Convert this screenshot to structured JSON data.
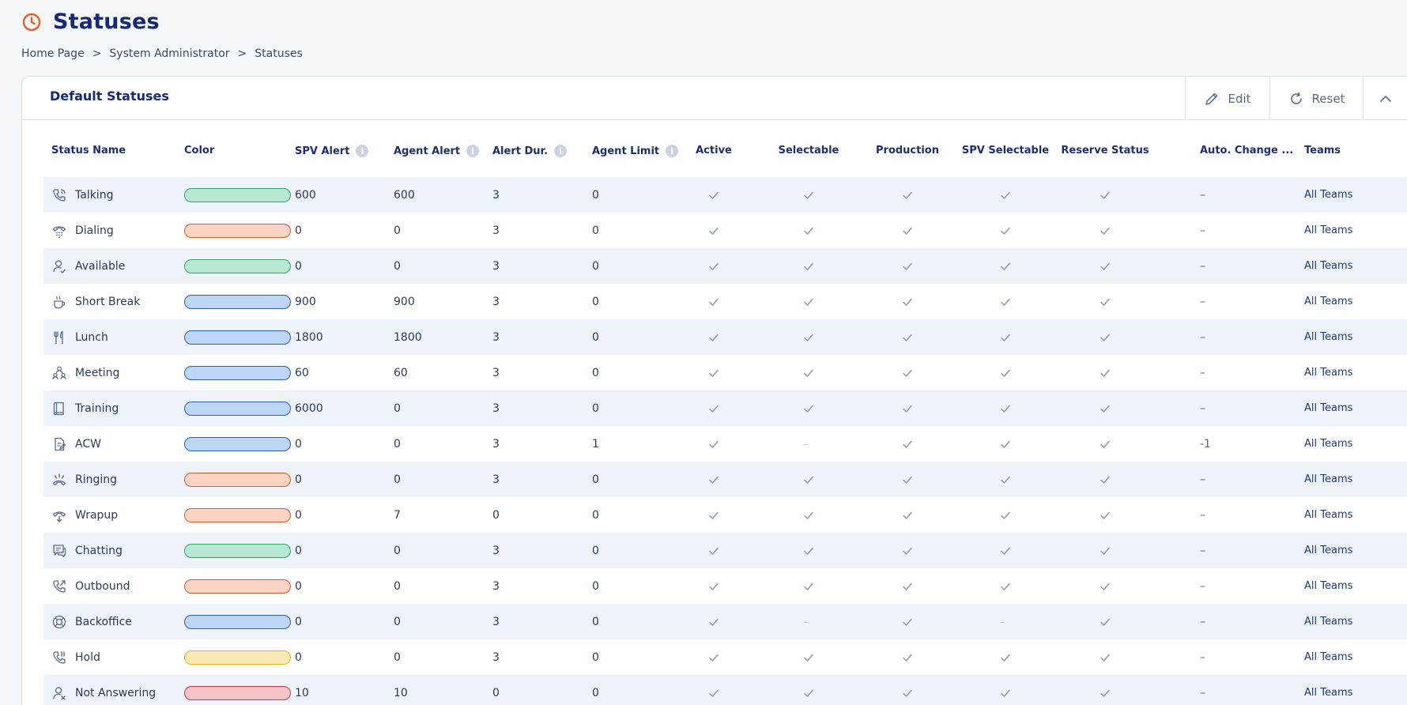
{
  "page": {
    "title": "Statuses",
    "breadcrumb": [
      "Home Page",
      "System Administrator",
      "Statuses"
    ],
    "breadcrumb_sep": ">"
  },
  "card": {
    "title": "Default Statuses",
    "edit_label": "Edit",
    "reset_label": "Reset"
  },
  "colors": {
    "green": {
      "fill": "#b8e9d3",
      "border": "#2fa86a"
    },
    "orange": {
      "fill": "#fdd3c4",
      "border": "#e0582f"
    },
    "blue": {
      "fill": "#bdd5f6",
      "border": "#2b5fb8"
    },
    "yellow": {
      "fill": "#fbe9b5",
      "border": "#d9b42c"
    },
    "red": {
      "fill": "#f6c3c8",
      "border": "#d93545"
    }
  },
  "columns": [
    {
      "label": "Status Name",
      "info": false
    },
    {
      "label": "Color",
      "info": false
    },
    {
      "label": "SPV Alert",
      "info": true
    },
    {
      "label": "Agent Alert",
      "info": true
    },
    {
      "label": "Alert Dur.",
      "info": true
    },
    {
      "label": "Agent Limit",
      "info": true
    },
    {
      "label": "Active",
      "info": false
    },
    {
      "label": "Selectable",
      "info": false
    },
    {
      "label": "Production",
      "info": false
    },
    {
      "label": "SPV Selectable",
      "info": false
    },
    {
      "label": "Reserve Status",
      "info": false
    },
    {
      "label": "Auto. Change ...",
      "info": false
    },
    {
      "label": "Teams",
      "info": false
    }
  ],
  "rows": [
    {
      "name": "Talking",
      "icon": "phone-talking-icon",
      "color": "green",
      "spv_alert": "600",
      "agent_alert": "600",
      "alert_dur": "3",
      "agent_limit": "0",
      "active": true,
      "selectable": true,
      "production": true,
      "spv_selectable": true,
      "reserve": true,
      "auto_change": "–",
      "teams": "All Teams"
    },
    {
      "name": "Dialing",
      "icon": "phone-dialing-icon",
      "color": "orange",
      "spv_alert": "0",
      "agent_alert": "0",
      "alert_dur": "3",
      "agent_limit": "0",
      "active": true,
      "selectable": true,
      "production": true,
      "spv_selectable": true,
      "reserve": true,
      "auto_change": "–",
      "teams": "All Teams"
    },
    {
      "name": "Available",
      "icon": "user-available-icon",
      "color": "green",
      "spv_alert": "0",
      "agent_alert": "0",
      "alert_dur": "3",
      "agent_limit": "0",
      "active": true,
      "selectable": true,
      "production": true,
      "spv_selectable": true,
      "reserve": true,
      "auto_change": "–",
      "teams": "All Teams"
    },
    {
      "name": "Short Break",
      "icon": "coffee-cup-icon",
      "color": "blue",
      "spv_alert": "900",
      "agent_alert": "900",
      "alert_dur": "3",
      "agent_limit": "0",
      "active": true,
      "selectable": true,
      "production": true,
      "spv_selectable": true,
      "reserve": true,
      "auto_change": "–",
      "teams": "All Teams"
    },
    {
      "name": "Lunch",
      "icon": "fork-knife-icon",
      "color": "blue",
      "spv_alert": "1800",
      "agent_alert": "1800",
      "alert_dur": "3",
      "agent_limit": "0",
      "active": true,
      "selectable": true,
      "production": true,
      "spv_selectable": true,
      "reserve": true,
      "auto_change": "–",
      "teams": "All Teams"
    },
    {
      "name": "Meeting",
      "icon": "meeting-group-icon",
      "color": "blue",
      "spv_alert": "60",
      "agent_alert": "60",
      "alert_dur": "3",
      "agent_limit": "0",
      "active": true,
      "selectable": true,
      "production": true,
      "spv_selectable": true,
      "reserve": true,
      "auto_change": "–",
      "teams": "All Teams"
    },
    {
      "name": "Training",
      "icon": "book-icon",
      "color": "blue",
      "spv_alert": "6000",
      "agent_alert": "0",
      "alert_dur": "3",
      "agent_limit": "0",
      "active": true,
      "selectable": true,
      "production": true,
      "spv_selectable": true,
      "reserve": true,
      "auto_change": "–",
      "teams": "All Teams"
    },
    {
      "name": "ACW",
      "icon": "document-edit-icon",
      "color": "blue",
      "spv_alert": "0",
      "agent_alert": "0",
      "alert_dur": "3",
      "agent_limit": "1",
      "active": true,
      "selectable": false,
      "production": true,
      "spv_selectable": true,
      "reserve": true,
      "auto_change": "-1",
      "teams": "All Teams"
    },
    {
      "name": "Ringing",
      "icon": "phone-ringing-icon",
      "color": "orange",
      "spv_alert": "0",
      "agent_alert": "0",
      "alert_dur": "3",
      "agent_limit": "0",
      "active": true,
      "selectable": true,
      "production": true,
      "spv_selectable": true,
      "reserve": true,
      "auto_change": "–",
      "teams": "All Teams"
    },
    {
      "name": "Wrapup",
      "icon": "wrapup-icon",
      "color": "orange",
      "spv_alert": "0",
      "agent_alert": "7",
      "alert_dur": "0",
      "agent_limit": "0",
      "active": true,
      "selectable": true,
      "production": true,
      "spv_selectable": true,
      "reserve": true,
      "auto_change": "–",
      "teams": "All Teams"
    },
    {
      "name": "Chatting",
      "icon": "chat-icon",
      "color": "green",
      "spv_alert": "0",
      "agent_alert": "0",
      "alert_dur": "3",
      "agent_limit": "0",
      "active": true,
      "selectable": true,
      "production": true,
      "spv_selectable": true,
      "reserve": true,
      "auto_change": "–",
      "teams": "All Teams"
    },
    {
      "name": "Outbound",
      "icon": "phone-outbound-icon",
      "color": "orange",
      "spv_alert": "0",
      "agent_alert": "0",
      "alert_dur": "3",
      "agent_limit": "0",
      "active": true,
      "selectable": true,
      "production": true,
      "spv_selectable": true,
      "reserve": true,
      "auto_change": "–",
      "teams": "All Teams"
    },
    {
      "name": "Backoffice",
      "icon": "lifebuoy-icon",
      "color": "blue",
      "spv_alert": "0",
      "agent_alert": "0",
      "alert_dur": "3",
      "agent_limit": "0",
      "active": true,
      "selectable": false,
      "production": true,
      "spv_selectable": false,
      "reserve": true,
      "auto_change": "–",
      "teams": "All Teams"
    },
    {
      "name": "Hold",
      "icon": "phone-hold-icon",
      "color": "yellow",
      "spv_alert": "0",
      "agent_alert": "0",
      "alert_dur": "3",
      "agent_limit": "0",
      "active": true,
      "selectable": true,
      "production": true,
      "spv_selectable": true,
      "reserve": true,
      "auto_change": "–",
      "teams": "All Teams"
    },
    {
      "name": "Not Answering",
      "icon": "user-x-icon",
      "color": "red",
      "spv_alert": "10",
      "agent_alert": "10",
      "alert_dur": "0",
      "agent_limit": "0",
      "active": true,
      "selectable": true,
      "production": true,
      "spv_selectable": true,
      "reserve": true,
      "auto_change": "–",
      "teams": "All Teams"
    }
  ]
}
